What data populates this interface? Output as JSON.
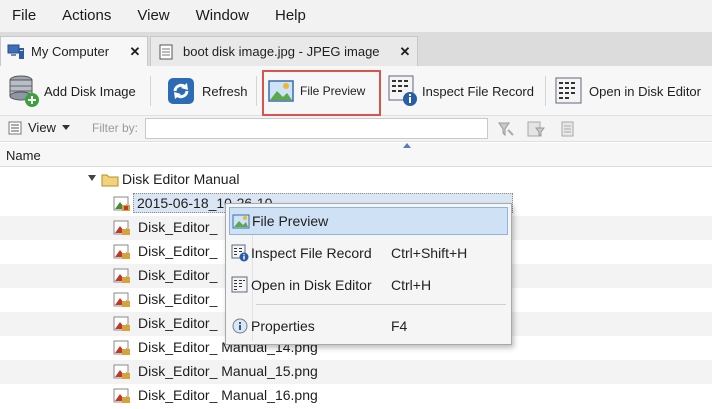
{
  "menu": [
    "File",
    "Actions",
    "View",
    "Window",
    "Help"
  ],
  "tabs": [
    {
      "label": "My Computer",
      "close": "✕"
    },
    {
      "label": "boot disk image.jpg - JPEG image",
      "close": "✕"
    }
  ],
  "toolbar": {
    "add_disk_image": "Add Disk Image",
    "refresh": "Refresh",
    "file_preview": "File Preview",
    "inspect_file_record": "Inspect File Record",
    "open_in_disk_editor": "Open in Disk Editor"
  },
  "filterbar": {
    "view_label": "View",
    "filter_label": "Filter by:",
    "filter_value": ""
  },
  "columns": {
    "name": "Name"
  },
  "tree": {
    "folder": "Disk Editor Manual",
    "files": [
      "2015-06-18_10-26-10",
      "Disk_Editor_",
      "Disk_Editor_",
      "Disk_Editor_",
      "Disk_Editor_",
      "Disk_Editor_",
      "Disk_Editor_ Manual_14.png",
      "Disk_Editor_ Manual_15.png",
      "Disk_Editor_ Manual_16.png"
    ]
  },
  "context_menu": {
    "items": [
      {
        "label": "File Preview",
        "shortcut": ""
      },
      {
        "label": "Inspect File Record",
        "shortcut": "Ctrl+Shift+H"
      },
      {
        "label": "Open in Disk Editor",
        "shortcut": "Ctrl+H"
      },
      {
        "label": "Properties",
        "shortcut": "F4"
      }
    ]
  },
  "colors": {
    "highlight": "#d9534f",
    "selection": "#dbe6f4",
    "menu_hover": "#cfe1f5"
  }
}
